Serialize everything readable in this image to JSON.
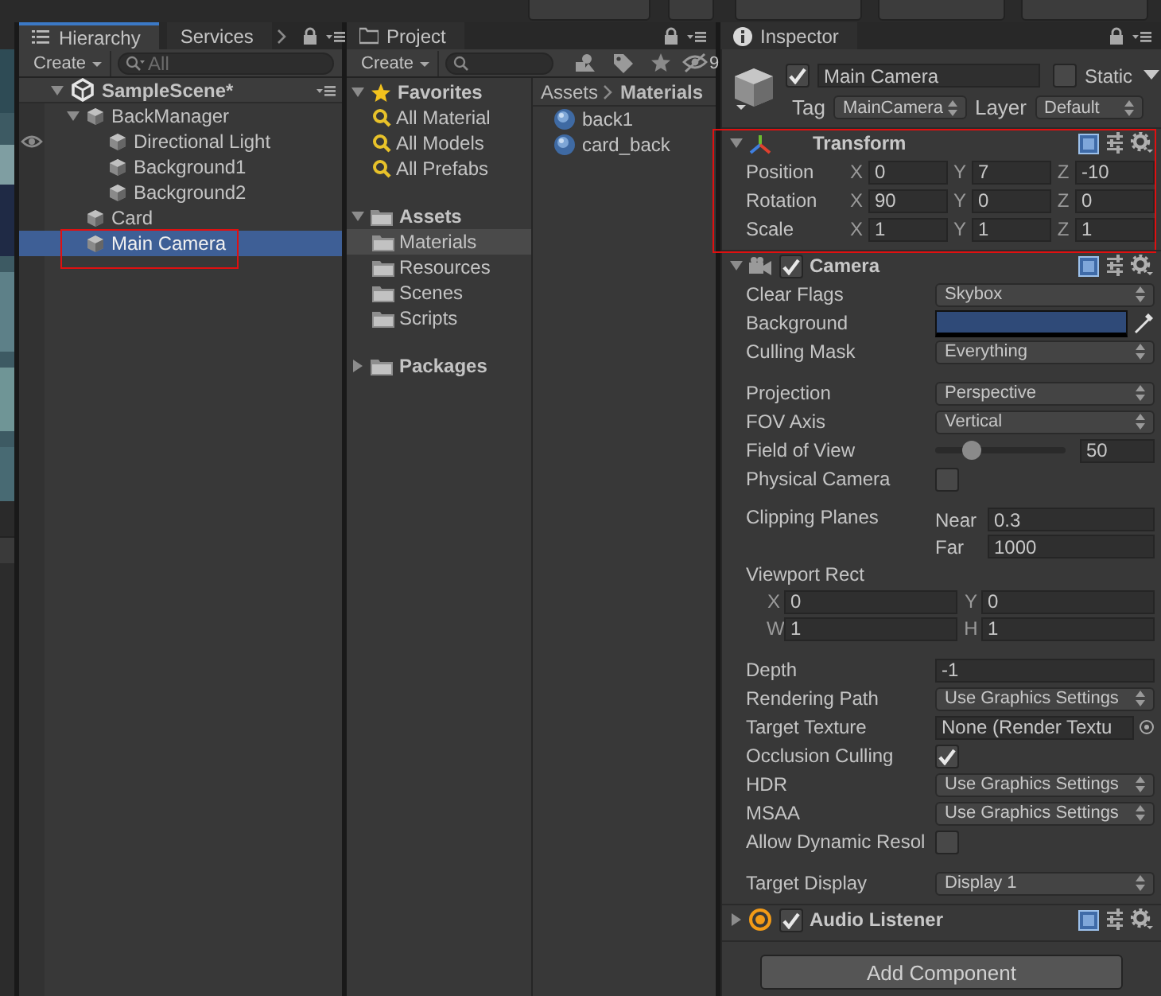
{
  "hierarchy": {
    "tabs": [
      {
        "label": "Hierarchy",
        "selected": true
      },
      {
        "label": "Services",
        "selected": false
      }
    ],
    "create": "Create",
    "search_placeholder": "All",
    "scene": {
      "name": "SampleScene*",
      "expanded": true
    },
    "items": [
      {
        "name": "BackManager",
        "expanded": true,
        "selected": false,
        "highlighted": false,
        "children": [
          {
            "name": "Directional Light",
            "selected": false,
            "highlighted": false,
            "eye": true
          },
          {
            "name": "Background1",
            "selected": false,
            "highlighted": false,
            "eye": false
          },
          {
            "name": "Background2",
            "selected": false,
            "highlighted": false,
            "eye": false
          }
        ]
      },
      {
        "name": "Card",
        "selected": false,
        "highlighted": false
      },
      {
        "name": "Main Camera",
        "selected": true,
        "highlighted": true
      }
    ]
  },
  "project": {
    "tab": {
      "label": "Project",
      "selected": false
    },
    "create": "Create",
    "hidden_count": "9",
    "tree": [
      {
        "name": "Favorites",
        "kind": "favorites",
        "expanded": true,
        "children": [
          {
            "name": "All Material",
            "kind": "search",
            "selected": false
          },
          {
            "name": "All Models",
            "kind": "search",
            "selected": false
          },
          {
            "name": "All Prefabs",
            "kind": "search",
            "selected": false
          }
        ]
      },
      {
        "name": "Assets",
        "kind": "folder",
        "expanded": true,
        "children": [
          {
            "name": "Materials",
            "kind": "folder",
            "selected": true
          },
          {
            "name": "Resources",
            "kind": "folder",
            "selected": false
          },
          {
            "name": "Scenes",
            "kind": "folder",
            "selected": false
          },
          {
            "name": "Scripts",
            "kind": "folder",
            "selected": false
          }
        ]
      },
      {
        "name": "Packages",
        "kind": "folder",
        "expanded": false
      }
    ],
    "breadcrumb": [
      "Assets",
      "Materials"
    ],
    "files": [
      "back1",
      "card_back"
    ]
  },
  "inspector": {
    "tab": {
      "label": "Inspector",
      "selected": false
    },
    "object": {
      "active": true,
      "name": "Main Camera",
      "static": false,
      "static_label": "Static",
      "tag_label": "Tag",
      "tag": "MainCamera",
      "layer_label": "Layer",
      "layer": "Default"
    },
    "components": [
      {
        "kind": "transform",
        "title": "Transform",
        "expanded": true,
        "highlighted": true,
        "rows": [
          {
            "label": "Position",
            "axes": [
              {
                "axis": "X",
                "value": "0"
              },
              {
                "axis": "Y",
                "value": "7"
              },
              {
                "axis": "Z",
                "value": "-10"
              }
            ]
          },
          {
            "label": "Rotation",
            "axes": [
              {
                "axis": "X",
                "value": "90"
              },
              {
                "axis": "Y",
                "value": "0"
              },
              {
                "axis": "Z",
                "value": "0"
              }
            ]
          },
          {
            "label": "Scale",
            "axes": [
              {
                "axis": "X",
                "value": "1"
              },
              {
                "axis": "Y",
                "value": "1"
              },
              {
                "axis": "Z",
                "value": "1"
              }
            ]
          }
        ]
      },
      {
        "kind": "camera",
        "title": "Camera",
        "enabled": true,
        "expanded": true,
        "fields": [
          {
            "kind": "dropdown",
            "label": "Clear Flags",
            "value": "Skybox"
          },
          {
            "kind": "color",
            "label": "Background",
            "color": "#2f4a78"
          },
          {
            "kind": "dropdown",
            "label": "Culling Mask",
            "value": "Everything"
          },
          {
            "kind": "spacer"
          },
          {
            "kind": "dropdown",
            "label": "Projection",
            "value": "Perspective"
          },
          {
            "kind": "dropdown",
            "label": "FOV Axis",
            "value": "Vertical"
          },
          {
            "kind": "slider",
            "label": "Field of View",
            "level": 0.28,
            "value": "50"
          },
          {
            "kind": "checkbox",
            "label": "Physical Camera",
            "checked": false
          },
          {
            "kind": "spacer"
          },
          {
            "kind": "clip",
            "label": "Clipping Planes",
            "near_label": "Near",
            "near": "0.3",
            "far_label": "Far",
            "far": "1000"
          },
          {
            "kind": "rect",
            "label": "Viewport Rect",
            "parts": [
              {
                "axis": "X",
                "value": "0"
              },
              {
                "axis": "Y",
                "value": "0"
              },
              {
                "axis": "W",
                "value": "1"
              },
              {
                "axis": "H",
                "value": "1"
              }
            ]
          },
          {
            "kind": "spacer"
          },
          {
            "kind": "number",
            "label": "Depth",
            "value": "-1"
          },
          {
            "kind": "dropdown",
            "label": "Rendering Path",
            "value": "Use Graphics Settings"
          },
          {
            "kind": "object",
            "label": "Target Texture",
            "value": "None (Render Textu"
          },
          {
            "kind": "checkbox",
            "label": "Occlusion Culling",
            "checked": true
          },
          {
            "kind": "dropdown",
            "label": "HDR",
            "value": "Use Graphics Settings"
          },
          {
            "kind": "dropdown",
            "label": "MSAA",
            "value": "Use Graphics Settings"
          },
          {
            "kind": "checkbox",
            "label": "Allow Dynamic Resol",
            "checked": false
          },
          {
            "kind": "spacer"
          },
          {
            "kind": "dropdown",
            "label": "Target Display",
            "value": "Display 1"
          }
        ]
      },
      {
        "kind": "audio",
        "title": "Audio Listener",
        "enabled": true,
        "expanded": false
      }
    ],
    "add_component": "Add Component"
  }
}
